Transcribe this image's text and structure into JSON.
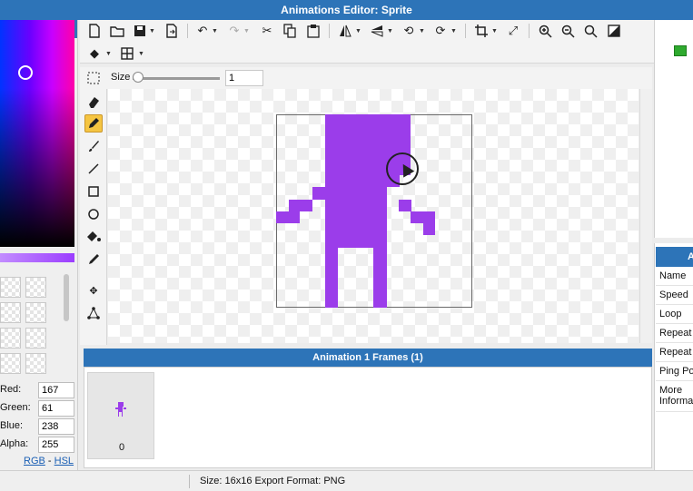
{
  "window": {
    "title": "Animations Editor: Sprite"
  },
  "color_panel": {
    "fields": [
      {
        "label": "Red:",
        "value": "167"
      },
      {
        "label": "Green:",
        "value": "61"
      },
      {
        "label": "Blue:",
        "value": "238"
      },
      {
        "label": "Alpha:",
        "value": "255"
      }
    ],
    "mode_links": {
      "rgb": "RGB",
      "separator": "-",
      "hsl": "HSL"
    }
  },
  "toolbar": {
    "icons": [
      "new-file-icon",
      "open-folder-icon",
      "save-icon",
      "export-icon",
      "undo-icon",
      "redo-icon",
      "cut-icon",
      "copy-icon",
      "paste-icon",
      "flip-horizontal-icon",
      "flip-vertical-icon",
      "rotate-left-icon",
      "rotate-right-icon",
      "crop-icon",
      "resize-icon",
      "zoom-in-icon",
      "zoom-out-icon",
      "zoom-fit-icon",
      "toggle-background-icon",
      "layers-icon",
      "grid-icon"
    ],
    "size_label": "Size",
    "size_value": "1"
  },
  "tools": [
    "select-tool",
    "eraser-tool",
    "pencil-tool",
    "brush-tool",
    "line-tool",
    "rectangle-tool",
    "ellipse-tool",
    "fill-tool",
    "eyedropper-tool",
    "move-point-tool",
    "bone-tool"
  ],
  "canvas": {
    "sprite_color": "#9b3dea",
    "active_tool": "pencil-tool"
  },
  "frames_panel": {
    "title": "Animation 1 Frames (1)",
    "frames": [
      {
        "index": "0"
      }
    ]
  },
  "properties_panel": {
    "header": "A",
    "rows": [
      "Name",
      "Speed",
      "Loop",
      "Repeat",
      "Repeat",
      "Ping Po",
      "More Informa"
    ]
  },
  "statusbar": {
    "text": "Size: 16x16   Export Format: PNG"
  },
  "colors": {
    "title_bar": "#2d74b8",
    "active_tool": "#f5c542"
  }
}
